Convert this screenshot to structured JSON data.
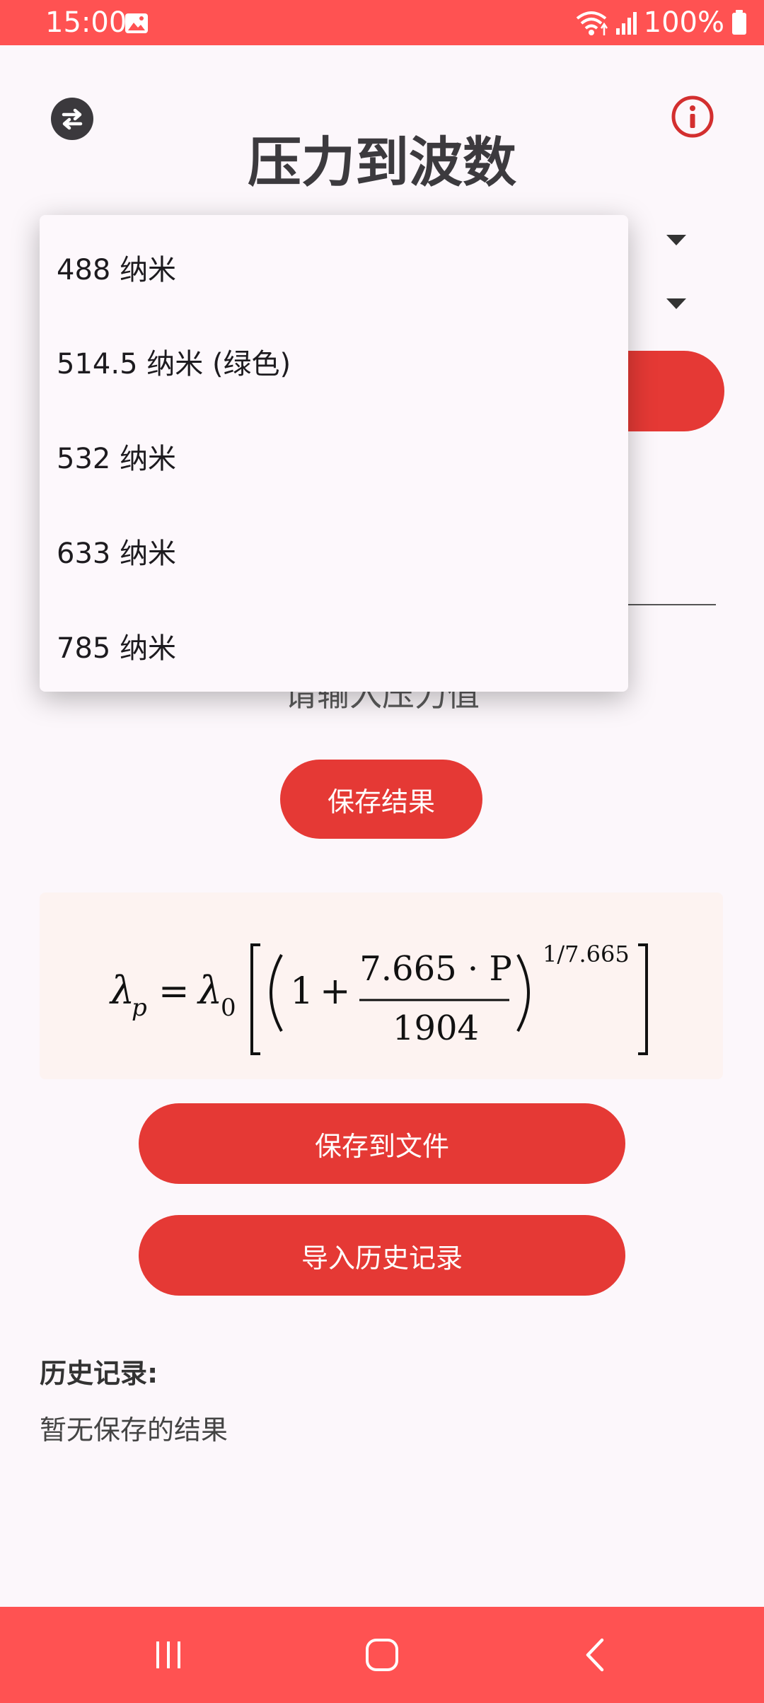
{
  "status_bar": {
    "time": "15:00",
    "battery_text": "100%",
    "icons": [
      "image-icon",
      "wifi-icon",
      "signal-icon",
      "battery-icon"
    ]
  },
  "header": {
    "title": "压力到波数",
    "left_icon": "swap-icon",
    "right_icon": "info-icon"
  },
  "dropdown": {
    "options": [
      "488 纳米",
      "514.5 纳米 (绿色)",
      "532 纳米",
      "633 纳米",
      "785 纳米"
    ]
  },
  "input": {
    "hint": "请输入压力值"
  },
  "buttons": {
    "save_result": "保存结果",
    "save_to_file": "保存到文件",
    "import_history": "导入历史记录"
  },
  "formula": {
    "lambda": "λ",
    "sub_p": "p",
    "equals": "=",
    "sub_0": "0",
    "one": "1",
    "plus": "+",
    "numerator": "7.665 · P",
    "denominator": "1904",
    "exponent": "1/7.665"
  },
  "history": {
    "title": "历史记录:",
    "empty_text": "暂无保存的结果"
  },
  "nav_bar": {
    "icons": [
      "recent-apps-icon",
      "home-icon",
      "back-icon"
    ]
  },
  "colors": {
    "accent": "#e53935",
    "bars": "#ff5252",
    "background": "#fcf7fb",
    "formula_bg": "#fdf3f1"
  }
}
